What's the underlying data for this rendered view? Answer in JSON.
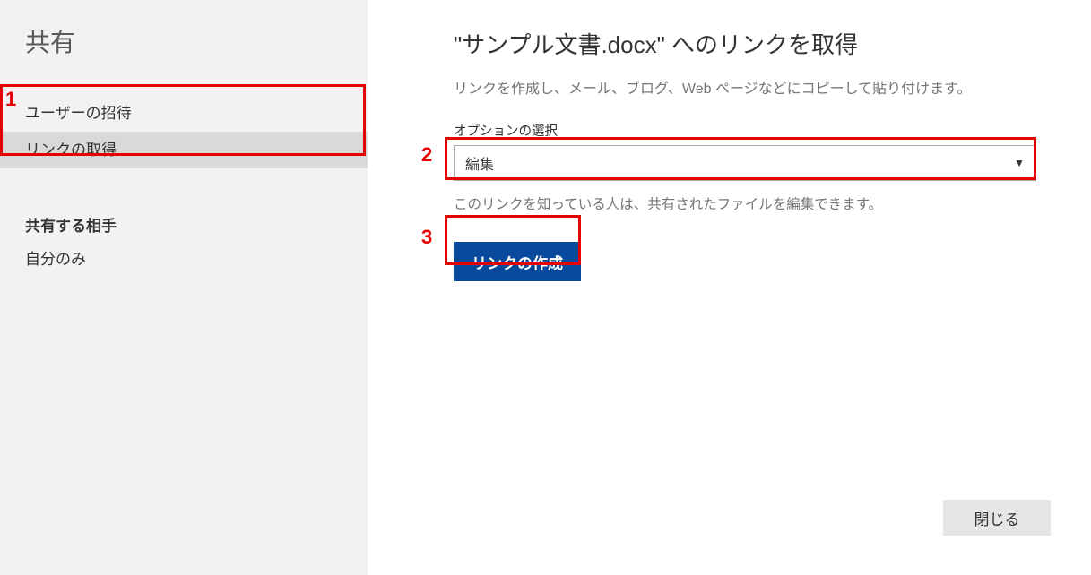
{
  "sidebar": {
    "title": "共有",
    "items": [
      {
        "label": "ユーザーの招待"
      },
      {
        "label": "リンクの取得"
      }
    ],
    "group_label": "共有する相手",
    "sub_label": "自分のみ"
  },
  "main": {
    "title": "\"サンプル文書.docx\" へのリンクを取得",
    "description": "リンクを作成し、メール、ブログ、Web ページなどにコピーして貼り付けます。",
    "option_label": "オプションの選択",
    "select_value": "編集",
    "permission_desc": "このリンクを知っている人は、共有されたファイルを編集できます。",
    "create_button": "リンクの作成",
    "close_button": "閉じる"
  },
  "callouts": [
    "1",
    "2",
    "3"
  ]
}
